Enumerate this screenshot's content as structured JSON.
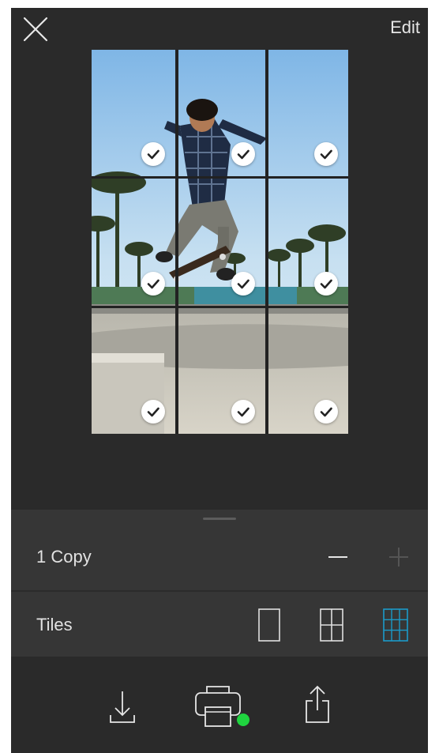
{
  "header": {
    "close_icon": "close-icon",
    "edit_label": "Edit"
  },
  "preview": {
    "rows": 3,
    "columns": 3,
    "tiles": [
      {
        "row": 1,
        "col": 1,
        "selected": true
      },
      {
        "row": 1,
        "col": 2,
        "selected": true
      },
      {
        "row": 1,
        "col": 3,
        "selected": true
      },
      {
        "row": 2,
        "col": 1,
        "selected": true
      },
      {
        "row": 2,
        "col": 2,
        "selected": true
      },
      {
        "row": 2,
        "col": 3,
        "selected": true
      },
      {
        "row": 3,
        "col": 1,
        "selected": true
      },
      {
        "row": 3,
        "col": 2,
        "selected": true
      },
      {
        "row": 3,
        "col": 3,
        "selected": true
      }
    ],
    "check_icon": "checkmark-icon"
  },
  "copies": {
    "label": "1 Copy",
    "decrement_icon": "minus-icon",
    "increment_icon": "plus-icon",
    "increment_enabled": false
  },
  "tiles_option": {
    "label": "Tiles",
    "options": [
      {
        "name": "single-tile-icon",
        "layout": "1x1",
        "selected": false
      },
      {
        "name": "four-tile-icon",
        "layout": "2x2",
        "selected": false
      },
      {
        "name": "nine-tile-icon",
        "layout": "3x3",
        "selected": true
      }
    ]
  },
  "actions": [
    {
      "name": "download-icon"
    },
    {
      "name": "print-icon",
      "status": "connected"
    },
    {
      "name": "share-icon"
    }
  ],
  "colors": {
    "background": "#2a2a2a",
    "panel": "#363636",
    "text": "#e2e2e2",
    "accent": "#1b9bc9",
    "status_green": "#1fd43f"
  }
}
